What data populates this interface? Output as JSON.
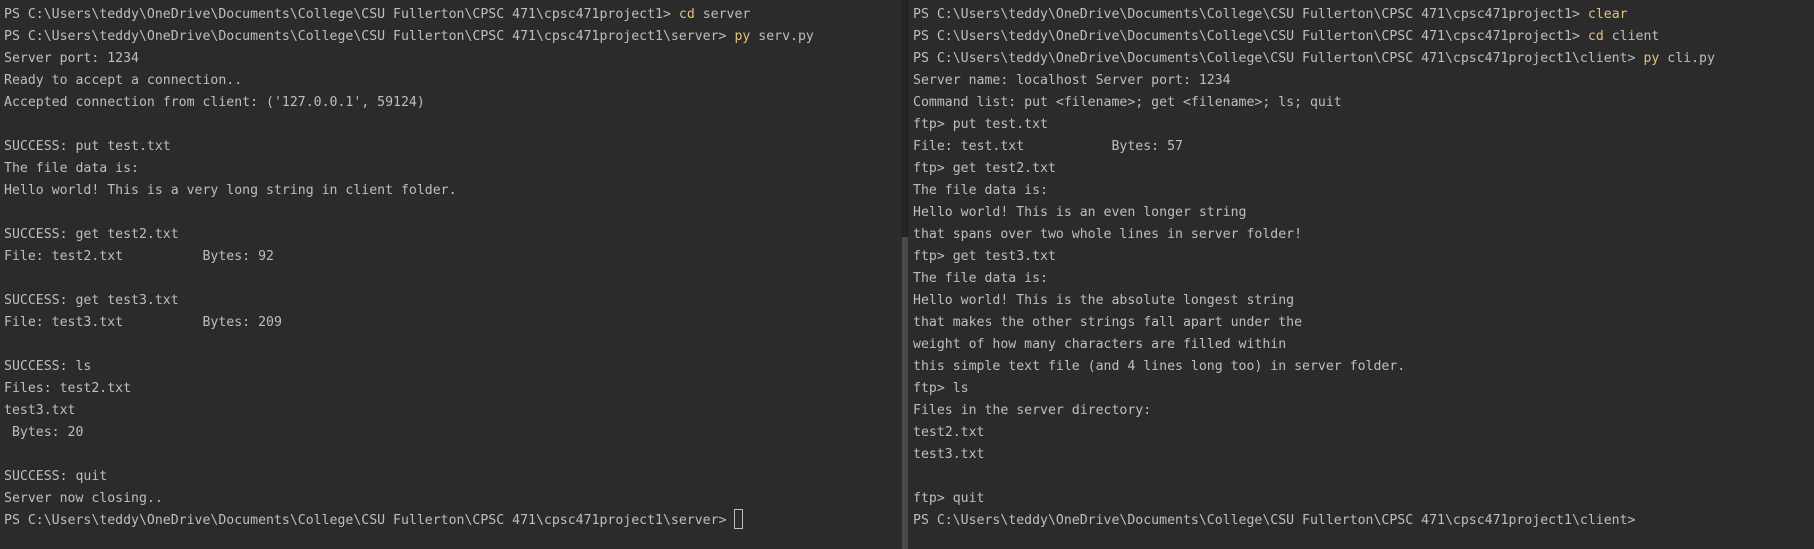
{
  "theme": {
    "background": "#2b2b2b",
    "text": "#bcbec4",
    "command": "#e5c07b",
    "accent": "#3574f0"
  },
  "left_terminal": {
    "lines": [
      {
        "prefix": "PS C:\\Users\\teddy\\OneDrive\\Documents\\College\\CSU Fullerton\\CPSC 471\\cpsc471project1> ",
        "cmd": "cd",
        "suffix": " server"
      },
      {
        "prefix": "PS C:\\Users\\teddy\\OneDrive\\Documents\\College\\CSU Fullerton\\CPSC 471\\cpsc471project1\\server> ",
        "cmd": "py",
        "suffix": " serv.py"
      },
      {
        "text": "Server port: 1234"
      },
      {
        "text": "Ready to accept a connection.."
      },
      {
        "text": "Accepted connection from client: ('127.0.0.1', 59124)"
      },
      {
        "text": ""
      },
      {
        "text": "SUCCESS: put test.txt"
      },
      {
        "text": "The file data is:"
      },
      {
        "text": "Hello world! This is a very long string in client folder."
      },
      {
        "text": ""
      },
      {
        "text": "SUCCESS: get test2.txt"
      },
      {
        "text": "File: test2.txt          Bytes: 92"
      },
      {
        "text": ""
      },
      {
        "text": "SUCCESS: get test3.txt"
      },
      {
        "text": "File: test3.txt          Bytes: 209"
      },
      {
        "text": ""
      },
      {
        "text": "SUCCESS: ls"
      },
      {
        "text": "Files: test2.txt"
      },
      {
        "text": "test3.txt"
      },
      {
        "text": " Bytes: 20"
      },
      {
        "text": ""
      },
      {
        "text": "SUCCESS: quit"
      },
      {
        "text": "Server now closing.."
      },
      {
        "prefix": "PS C:\\Users\\teddy\\OneDrive\\Documents\\College\\CSU Fullerton\\CPSC 471\\cpsc471project1\\server> ",
        "cursor": true
      }
    ]
  },
  "right_terminal": {
    "lines": [
      {
        "prefix": "PS C:\\Users\\teddy\\OneDrive\\Documents\\College\\CSU Fullerton\\CPSC 471\\cpsc471project1> ",
        "cmd": "clear",
        "suffix": ""
      },
      {
        "prefix": "PS C:\\Users\\teddy\\OneDrive\\Documents\\College\\CSU Fullerton\\CPSC 471\\cpsc471project1> ",
        "cmd": "cd",
        "suffix": " client"
      },
      {
        "prefix": "PS C:\\Users\\teddy\\OneDrive\\Documents\\College\\CSU Fullerton\\CPSC 471\\cpsc471project1\\client> ",
        "cmd": "py",
        "suffix": " cli.py"
      },
      {
        "text": "Server name: localhost Server port: 1234"
      },
      {
        "text": "Command list: put <filename>; get <filename>; ls; quit"
      },
      {
        "text": "ftp> put test.txt"
      },
      {
        "text": "File: test.txt           Bytes: 57"
      },
      {
        "text": "ftp> get test2.txt"
      },
      {
        "text": "The file data is:"
      },
      {
        "text": "Hello world! This is an even longer string"
      },
      {
        "text": "that spans over two whole lines in server folder!"
      },
      {
        "text": "ftp> get test3.txt"
      },
      {
        "text": "The file data is:"
      },
      {
        "text": "Hello world! This is the absolute longest string"
      },
      {
        "text": "that makes the other strings fall apart under the"
      },
      {
        "text": "weight of how many characters are filled within"
      },
      {
        "text": "this simple text file (and 4 lines long too) in server folder."
      },
      {
        "text": "ftp> ls"
      },
      {
        "text": "Files in the server directory:"
      },
      {
        "text": "test2.txt"
      },
      {
        "text": "test3.txt"
      },
      {
        "text": ""
      },
      {
        "text": "ftp> quit"
      },
      {
        "text": "PS C:\\Users\\teddy\\OneDrive\\Documents\\College\\CSU Fullerton\\CPSC 471\\cpsc471project1\\client>"
      }
    ]
  }
}
